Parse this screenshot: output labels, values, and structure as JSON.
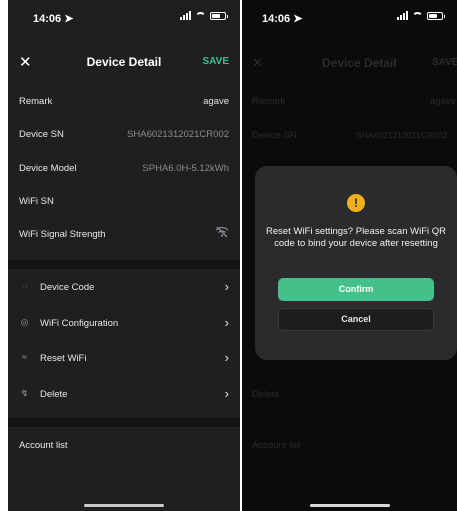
{
  "left": {
    "status": {
      "time": "14:06 ➤"
    },
    "nav": {
      "close": "✕",
      "title": "Device Detail",
      "save": "SAVE"
    },
    "info_rows": [
      {
        "label": "Remark",
        "value": "agave"
      },
      {
        "label": "Device SN",
        "value": "SHA6021312021CR002"
      },
      {
        "label": "Device Model",
        "value": "SPHA6.0H-5.12kWh"
      },
      {
        "label": "WiFi SN",
        "value": ""
      },
      {
        "label": "WiFi Signal Strength",
        "value": "",
        "icon": "wifi-off-icon"
      }
    ],
    "menu_rows": [
      {
        "label": "Device Code",
        "icon": "device-code-icon"
      },
      {
        "label": "WiFi Configuration",
        "icon": "wifi-config-icon"
      },
      {
        "label": "Reset WiFi",
        "icon": "wifi-reset-icon"
      },
      {
        "label": "Delete",
        "icon": "delete-icon"
      }
    ],
    "account": {
      "label": "Account list"
    }
  },
  "right": {
    "status": {
      "time": "14:06 ➤"
    },
    "dialog": {
      "message": "Reset WiFi settings? Please scan WiFi QR code to bind your device after resetting",
      "confirm": "Confirm",
      "cancel": "Cancel",
      "icon": "warning-icon",
      "accent": "#46c08a",
      "warning_color": "#f2b01e"
    },
    "background": {
      "close": "✕",
      "title": "Device Detail",
      "save": "SAVE",
      "remark_label": "Remark",
      "remark_value": "agave",
      "sn_label": "Device SN",
      "sn_value": "SHA6021312021CR002",
      "delete_label": "Delete",
      "account_label": "Account list"
    }
  }
}
